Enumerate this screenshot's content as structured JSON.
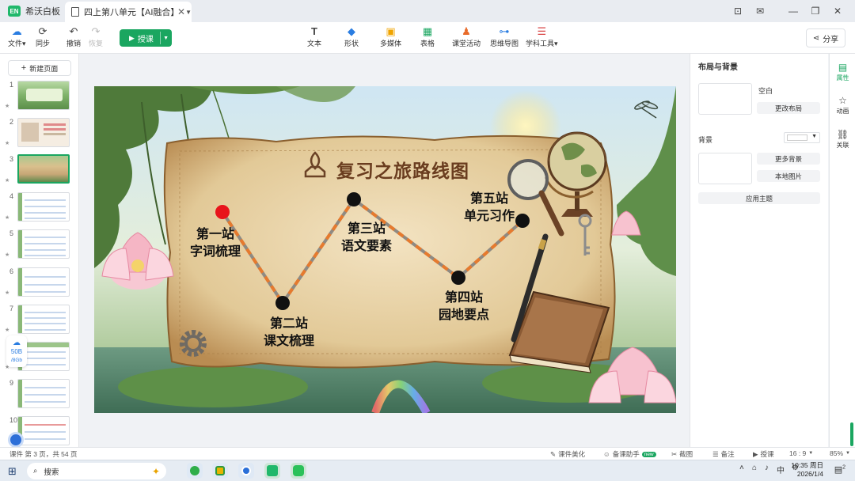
{
  "app": {
    "name": "希沃白板",
    "logo_text": "EN"
  },
  "tab": {
    "title": "四上第八单元【AI融合】"
  },
  "toolbar": {
    "file": "文件",
    "sync": "同步",
    "undo": "撤销",
    "redo": "恢复",
    "teach": "授课",
    "text": "文本",
    "shape": "形状",
    "media": "多媒体",
    "table": "表格",
    "activity": "课堂活动",
    "mindmap": "思维导图",
    "subject_tools": "学科工具",
    "share": "分享"
  },
  "left_panel": {
    "new_page": "新建页面",
    "pages": [
      "1",
      "2",
      "3",
      "4",
      "5",
      "6",
      "7",
      "8",
      "9",
      "10"
    ],
    "cloud": {
      "size": "50B",
      "unit": "/8Gb"
    }
  },
  "slide": {
    "title": "复习之旅路线图",
    "stations": [
      {
        "line1": "第一站",
        "line2": "字词梳理"
      },
      {
        "line1": "第二站",
        "line2": "课文梳理"
      },
      {
        "line1": "第三站",
        "line2": "语文要素"
      },
      {
        "line1": "第四站",
        "line2": "园地要点"
      },
      {
        "line1": "第五站",
        "line2": "单元习作"
      }
    ]
  },
  "right_panel": {
    "title": "布局与背景",
    "layout_blank": "空白",
    "change_layout": "更改布局",
    "background": "背景",
    "more_bg": "更多背景",
    "local_img": "本地图片",
    "apply_theme": "应用主题"
  },
  "side_tabs": {
    "props": "属性",
    "anim": "动画",
    "link": "关联"
  },
  "status": {
    "page_info": "课件 第 3 页，共 54 页",
    "beautify": "课件美化",
    "assistant": "备课助手",
    "new_badge": "new",
    "screenshot": "截图",
    "notes": "备注",
    "teach": "授课",
    "ratio": "16 : 9",
    "zoom": "85%"
  },
  "taskbar": {
    "search": "搜索",
    "ime": "中",
    "time": "10:35 周日",
    "date": "2026/1/4",
    "notif_count": "2"
  },
  "colors": {
    "accent": "#1aa660",
    "station_start": "#e8141b",
    "path": "#e67a2e"
  }
}
